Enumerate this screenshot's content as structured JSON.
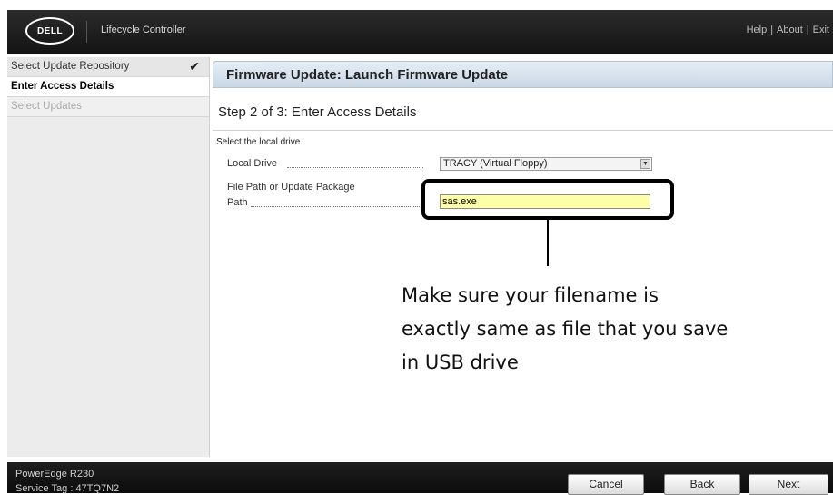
{
  "header": {
    "logo_text": "DELL",
    "product": "Lifecycle Controller",
    "links": [
      "Help",
      "About",
      "Exit"
    ],
    "separator": "|"
  },
  "sidebar": {
    "items": [
      {
        "label": "Select Update Repository",
        "state": "done",
        "check": "✔"
      },
      {
        "label": "Enter Access Details",
        "state": "active"
      },
      {
        "label": "Select Updates",
        "state": "disabled"
      }
    ]
  },
  "main": {
    "title": "Firmware Update: Launch Firmware Update",
    "step": "Step 2 of 3: Enter Access Details",
    "instruction": "Select the local drive.",
    "local_drive": {
      "label": "Local Drive",
      "value": "TRACY (Virtual Floppy)",
      "icon": "dropdown-arrow-icon"
    },
    "file_path": {
      "label_line1": "File Path or Update Package",
      "label_line2": "Path",
      "value": "sas.exe"
    }
  },
  "annotation": {
    "text": "Make sure your filename is exactly same as file that you save in USB drive"
  },
  "footer": {
    "model": "PowerEdge R230",
    "service_tag": "Service Tag : 47TQ7N2",
    "buttons": {
      "cancel": "Cancel",
      "back": "Back",
      "next": "Next"
    }
  },
  "colors": {
    "header_bg": "#1c1c1c",
    "input_highlight": "#ffffa8",
    "title_bar": "#d3dfeb"
  }
}
